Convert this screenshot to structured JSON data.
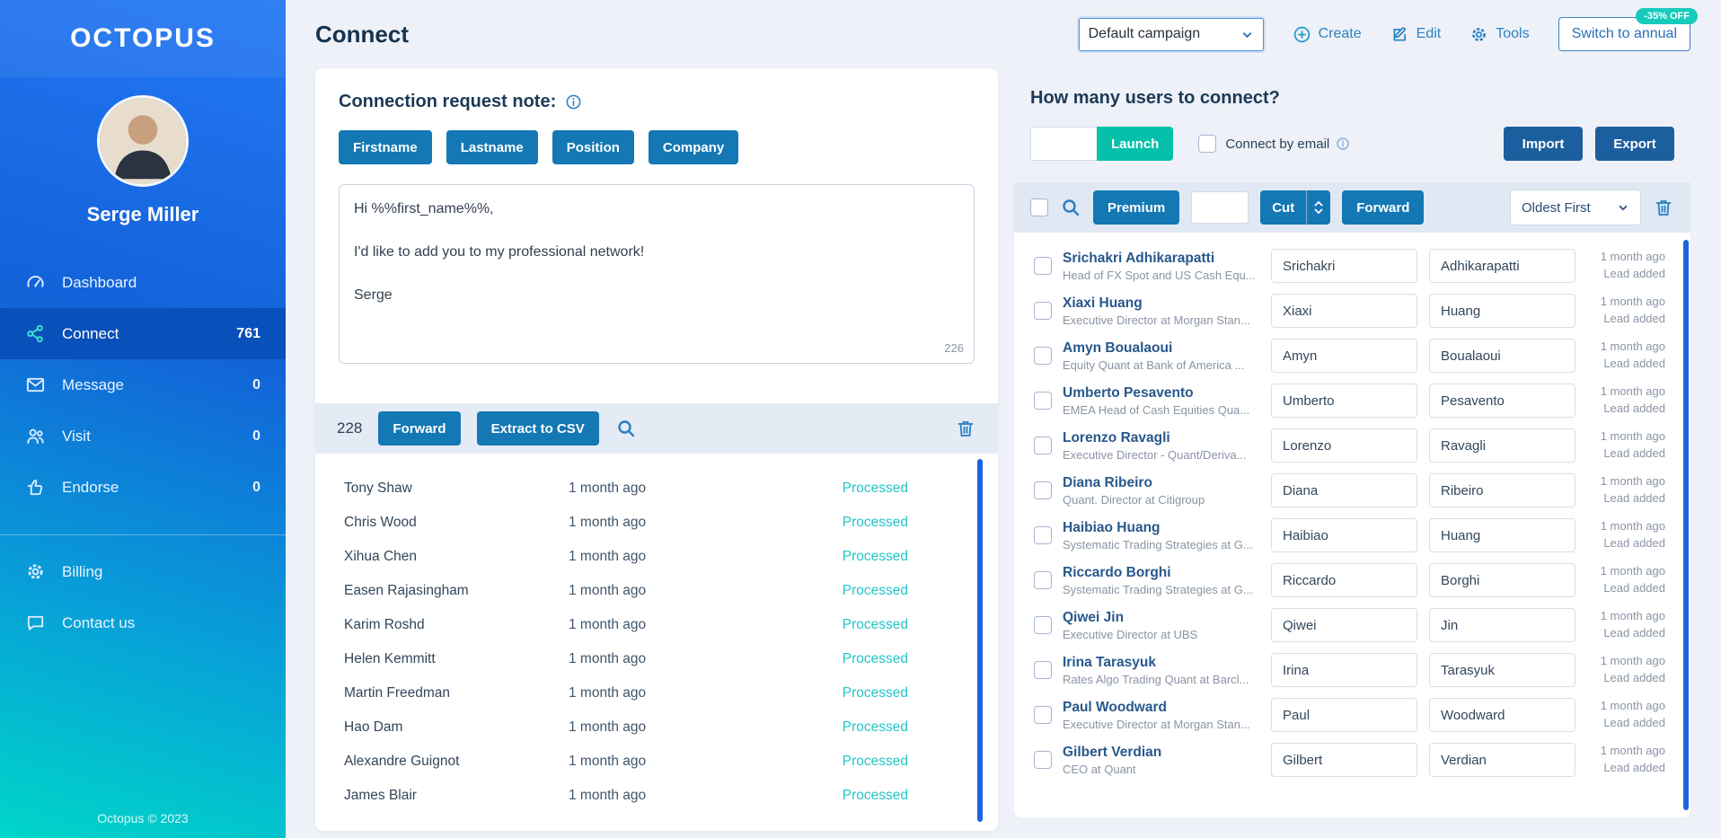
{
  "sidebar": {
    "logo": "OCTOPUS",
    "user_name": "Serge Miller",
    "menu": [
      {
        "label": "Dashboard"
      },
      {
        "label": "Connect",
        "count": "761"
      },
      {
        "label": "Message",
        "count": "0"
      },
      {
        "label": "Visit",
        "count": "0"
      },
      {
        "label": "Endorse",
        "count": "0"
      }
    ],
    "secondary": [
      {
        "label": "Billing"
      },
      {
        "label": "Contact us"
      }
    ],
    "footer": "Octopus © 2023"
  },
  "header": {
    "title": "Connect",
    "campaign": "Default campaign",
    "create": "Create",
    "edit": "Edit",
    "tools": "Tools",
    "switch_annual": "Switch to annual",
    "discount": "-35% OFF"
  },
  "colors": {
    "accent_blue": "#1478b4",
    "teal": "#05c1ab",
    "processed_teal": "#23c5c7",
    "scrollbar_blue": "#1b64e0"
  },
  "note_panel": {
    "title": "Connection request note:",
    "tokens": [
      "Firstname",
      "Lastname",
      "Position",
      "Company"
    ],
    "message": "Hi %%first_name%%,\n\nI'd like to add you to my professional network!\n\nSerge",
    "char_count": "226",
    "count": "228",
    "forward": "Forward",
    "extract": "Extract to CSV",
    "rows": [
      {
        "name": "Tony Shaw",
        "time": "1 month ago",
        "status": "Processed"
      },
      {
        "name": "Chris Wood",
        "time": "1 month ago",
        "status": "Processed"
      },
      {
        "name": "Xihua Chen",
        "time": "1 month ago",
        "status": "Processed"
      },
      {
        "name": "Easen Rajasingham",
        "time": "1 month ago",
        "status": "Processed"
      },
      {
        "name": "Karim Roshd",
        "time": "1 month ago",
        "status": "Processed"
      },
      {
        "name": "Helen Kemmitt",
        "time": "1 month ago",
        "status": "Processed"
      },
      {
        "name": "Martin Freedman",
        "time": "1 month ago",
        "status": "Processed"
      },
      {
        "name": "Hao Dam",
        "time": "1 month ago",
        "status": "Processed"
      },
      {
        "name": "Alexandre Guignot",
        "time": "1 month ago",
        "status": "Processed"
      },
      {
        "name": "James Blair",
        "time": "1 month ago",
        "status": "Processed"
      }
    ]
  },
  "connect_panel": {
    "title": "How many users to connect?",
    "launch": "Launch",
    "connect_by_email": "Connect by email",
    "import": "Import",
    "export": "Export",
    "premium": "Premium",
    "cut": "Cut",
    "forward": "Forward",
    "sort": "Oldest First",
    "users": [
      {
        "name": "Srichakri Adhikarapatti",
        "subtitle": "Head of FX Spot and US Cash Equ...",
        "first": "Srichakri",
        "last": "Adhikarapatti",
        "time": "1 month ago",
        "status": "Lead added"
      },
      {
        "name": "Xiaxi Huang",
        "subtitle": "Executive Director at Morgan Stan...",
        "first": "Xiaxi",
        "last": "Huang",
        "time": "1 month ago",
        "status": "Lead added"
      },
      {
        "name": "Amyn Boualaoui",
        "subtitle": "Equity Quant at Bank of America ...",
        "first": "Amyn",
        "last": "Boualaoui",
        "time": "1 month ago",
        "status": "Lead added"
      },
      {
        "name": "Umberto Pesavento",
        "subtitle": "EMEA Head of Cash Equities Qua...",
        "first": "Umberto",
        "last": "Pesavento",
        "time": "1 month ago",
        "status": "Lead added"
      },
      {
        "name": "Lorenzo Ravagli",
        "subtitle": "Executive Director - Quant/Deriva...",
        "first": "Lorenzo",
        "last": "Ravagli",
        "time": "1 month ago",
        "status": "Lead added"
      },
      {
        "name": "Diana Ribeiro",
        "subtitle": "Quant. Director at Citigroup",
        "first": "Diana",
        "last": "Ribeiro",
        "time": "1 month ago",
        "status": "Lead added"
      },
      {
        "name": "Haibiao Huang",
        "subtitle": "Systematic Trading Strategies at G...",
        "first": "Haibiao",
        "last": "Huang",
        "time": "1 month ago",
        "status": "Lead added"
      },
      {
        "name": "Riccardo Borghi",
        "subtitle": "Systematic Trading Strategies at G...",
        "first": "Riccardo",
        "last": "Borghi",
        "time": "1 month ago",
        "status": "Lead added"
      },
      {
        "name": "Qiwei Jin",
        "subtitle": "Executive Director at UBS",
        "first": "Qiwei",
        "last": "Jin",
        "time": "1 month ago",
        "status": "Lead added"
      },
      {
        "name": "Irina Tarasyuk",
        "subtitle": "Rates Algo Trading Quant at Barcl...",
        "first": "Irina",
        "last": "Tarasyuk",
        "time": "1 month ago",
        "status": "Lead added"
      },
      {
        "name": "Paul Woodward",
        "subtitle": "Executive Director at Morgan Stan...",
        "first": "Paul",
        "last": "Woodward",
        "time": "1 month ago",
        "status": "Lead added"
      },
      {
        "name": "Gilbert Verdian",
        "subtitle": "CEO at Quant",
        "first": "Gilbert",
        "last": "Verdian",
        "time": "1 month ago",
        "status": "Lead added"
      }
    ]
  }
}
